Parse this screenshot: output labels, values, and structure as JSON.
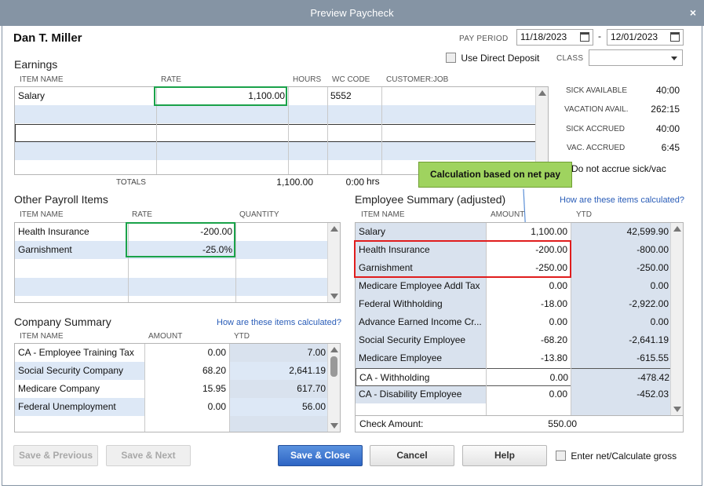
{
  "window": {
    "title": "Preview Paycheck",
    "close_glyph": "×"
  },
  "employee": {
    "name": "Dan T. Miller"
  },
  "pay_period": {
    "label": "PAY PERIOD",
    "start": "11/18/2023",
    "separator": "-",
    "end": "12/01/2023"
  },
  "direct_deposit": {
    "label": "Use Direct Deposit",
    "checked": false
  },
  "class_field": {
    "label": "CLASS",
    "value": ""
  },
  "earnings": {
    "title": "Earnings",
    "columns": [
      "ITEM NAME",
      "RATE",
      "HOURS",
      "WC CODE",
      "CUSTOMER:JOB"
    ],
    "rows": [
      {
        "item": "Salary",
        "rate": "1,100.00",
        "hours": "",
        "wc": "5552",
        "job": ""
      },
      {
        "item": "",
        "rate": "",
        "hours": "",
        "wc": "",
        "job": ""
      },
      {
        "item": "",
        "rate": "",
        "hours": "",
        "wc": "",
        "job": ""
      },
      {
        "item": "",
        "rate": "",
        "hours": "",
        "wc": "",
        "job": ""
      },
      {
        "item": "",
        "rate": "",
        "hours": "",
        "wc": "",
        "job": ""
      }
    ],
    "totals_label": "TOTALS",
    "total_rate": "1,100.00",
    "total_hours": "0:00",
    "hours_unit": "hrs"
  },
  "leave": [
    {
      "label": "SICK AVAILABLE",
      "value": "40:00"
    },
    {
      "label": "VACATION AVAIL.",
      "value": "262:15"
    },
    {
      "label": "SICK ACCRUED",
      "value": "40:00"
    },
    {
      "label": "VAC. ACCRUED",
      "value": "6:45"
    }
  ],
  "do_not_accrue": {
    "label": "Do not accrue sick/vac"
  },
  "callout": {
    "text": "Calculation based on net pay",
    "color": "#9fd35f"
  },
  "other_payroll": {
    "title": "Other Payroll Items",
    "columns": [
      "ITEM NAME",
      "RATE",
      "QUANTITY"
    ],
    "rows": [
      {
        "item": "Health Insurance",
        "rate": "-200.00",
        "qty": ""
      },
      {
        "item": "Garnishment",
        "rate": "-25.0%",
        "qty": ""
      },
      {
        "item": "",
        "rate": "",
        "qty": ""
      },
      {
        "item": "",
        "rate": "",
        "qty": ""
      }
    ]
  },
  "employee_summary": {
    "title": "Employee Summary (adjusted)",
    "link": "How are these items calculated?",
    "columns": [
      "ITEM NAME",
      "AMOUNT",
      "YTD"
    ],
    "rows": [
      {
        "item": "Salary",
        "amount": "1,100.00",
        "ytd": "42,599.90"
      },
      {
        "item": "Health Insurance",
        "amount": "-200.00",
        "ytd": "-800.00"
      },
      {
        "item": "Garnishment",
        "amount": "-250.00",
        "ytd": "-250.00"
      },
      {
        "item": "Medicare Employee Addl Tax",
        "amount": "0.00",
        "ytd": "0.00"
      },
      {
        "item": "Federal Withholding",
        "amount": "-18.00",
        "ytd": "-2,922.00"
      },
      {
        "item": "Advance Earned Income Cr...",
        "amount": "0.00",
        "ytd": "0.00"
      },
      {
        "item": "Social Security Employee",
        "amount": "-68.20",
        "ytd": "-2,641.19"
      },
      {
        "item": "Medicare Employee",
        "amount": "-13.80",
        "ytd": "-615.55"
      },
      {
        "item": "CA - Withholding",
        "amount": "0.00",
        "ytd": "-478.42"
      },
      {
        "item": "CA - Disability Employee",
        "amount": "0.00",
        "ytd": "-452.03"
      },
      {
        "item": "",
        "amount": "",
        "ytd": ""
      }
    ],
    "check_amount_label": "Check Amount:",
    "check_amount": "550.00"
  },
  "company_summary": {
    "title": "Company Summary",
    "link": "How are these items calculated?",
    "columns": [
      "ITEM NAME",
      "AMOUNT",
      "YTD"
    ],
    "rows": [
      {
        "item": "CA - Employee Training Tax",
        "amount": "0.00",
        "ytd": "7.00"
      },
      {
        "item": "Social Security Company",
        "amount": "68.20",
        "ytd": "2,641.19"
      },
      {
        "item": "Medicare Company",
        "amount": "15.95",
        "ytd": "617.70"
      },
      {
        "item": "Federal Unemployment",
        "amount": "0.00",
        "ytd": "56.00"
      },
      {
        "item": "",
        "amount": "",
        "ytd": ""
      }
    ]
  },
  "buttons": {
    "save_previous": "Save & Previous",
    "save_next": "Save & Next",
    "save_close": "Save & Close",
    "cancel": "Cancel",
    "help": "Help"
  },
  "enter_net": {
    "label": "Enter net/Calculate gross",
    "checked": false
  },
  "colors": {
    "title_bar": "#8594a4",
    "highlight_green": "#1aa24a",
    "highlight_red": "#e01d1d",
    "row_alt": "#dde8f6",
    "primary_button": "#2e65c4"
  }
}
